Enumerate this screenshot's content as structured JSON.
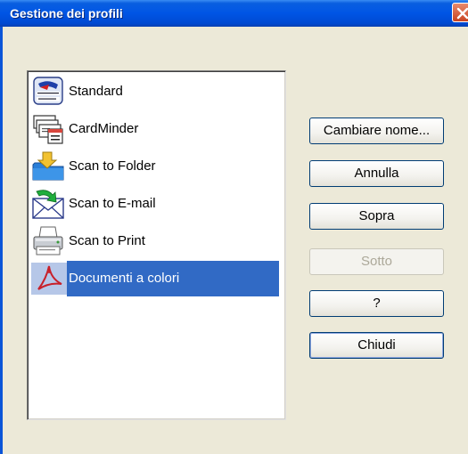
{
  "window": {
    "title": "Gestione dei profili"
  },
  "profiles": [
    {
      "label": "Standard",
      "icon": "scansnap-organizer-icon",
      "selected": false
    },
    {
      "label": "CardMinder",
      "icon": "cardminder-icon",
      "selected": false
    },
    {
      "label": "Scan to Folder",
      "icon": "folder-icon",
      "selected": false
    },
    {
      "label": "Scan to E-mail",
      "icon": "email-icon",
      "selected": false
    },
    {
      "label": "Scan to Print",
      "icon": "printer-icon",
      "selected": false
    },
    {
      "label": "Documenti a colori",
      "icon": "pdf-icon",
      "selected": true
    }
  ],
  "buttons": {
    "rename": "Cambiare nome...",
    "cancel": "Annulla",
    "up": "Sopra",
    "down": "Sotto",
    "help": "?",
    "close": "Chiudi"
  },
  "colors": {
    "titlebar": "#0055e5",
    "selection": "#316ac5",
    "dialog_bg": "#ece9d8"
  }
}
